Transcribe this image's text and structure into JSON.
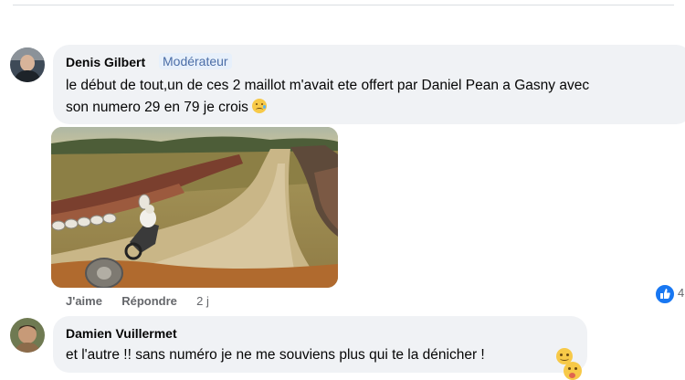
{
  "comments": [
    {
      "author": "Denis Gilbert",
      "badge": "Modérateur",
      "text_line1": "le début de tout,un de ces 2 maillot m'avait ete offert par Daniel Pean a Gasny avec",
      "text_line2": "son numero 29 en 79 je crois",
      "actions": {
        "like": "J'aime",
        "reply": "Répondre",
        "time": "2 j"
      },
      "reaction_count": "4",
      "reaction_icon": "thumbs-up-icon"
    },
    {
      "author": "Damien Vuillermet",
      "text_line1": "et l'autre !! sans numéro je ne me souviens plus qui te la dénicher !"
    }
  ],
  "colors": {
    "bubble": "#f0f2f5",
    "badge_text": "#4b6ea7",
    "badge_bg": "#e7f0fb",
    "meta": "#65676b",
    "like_blue": "#1877f2"
  }
}
